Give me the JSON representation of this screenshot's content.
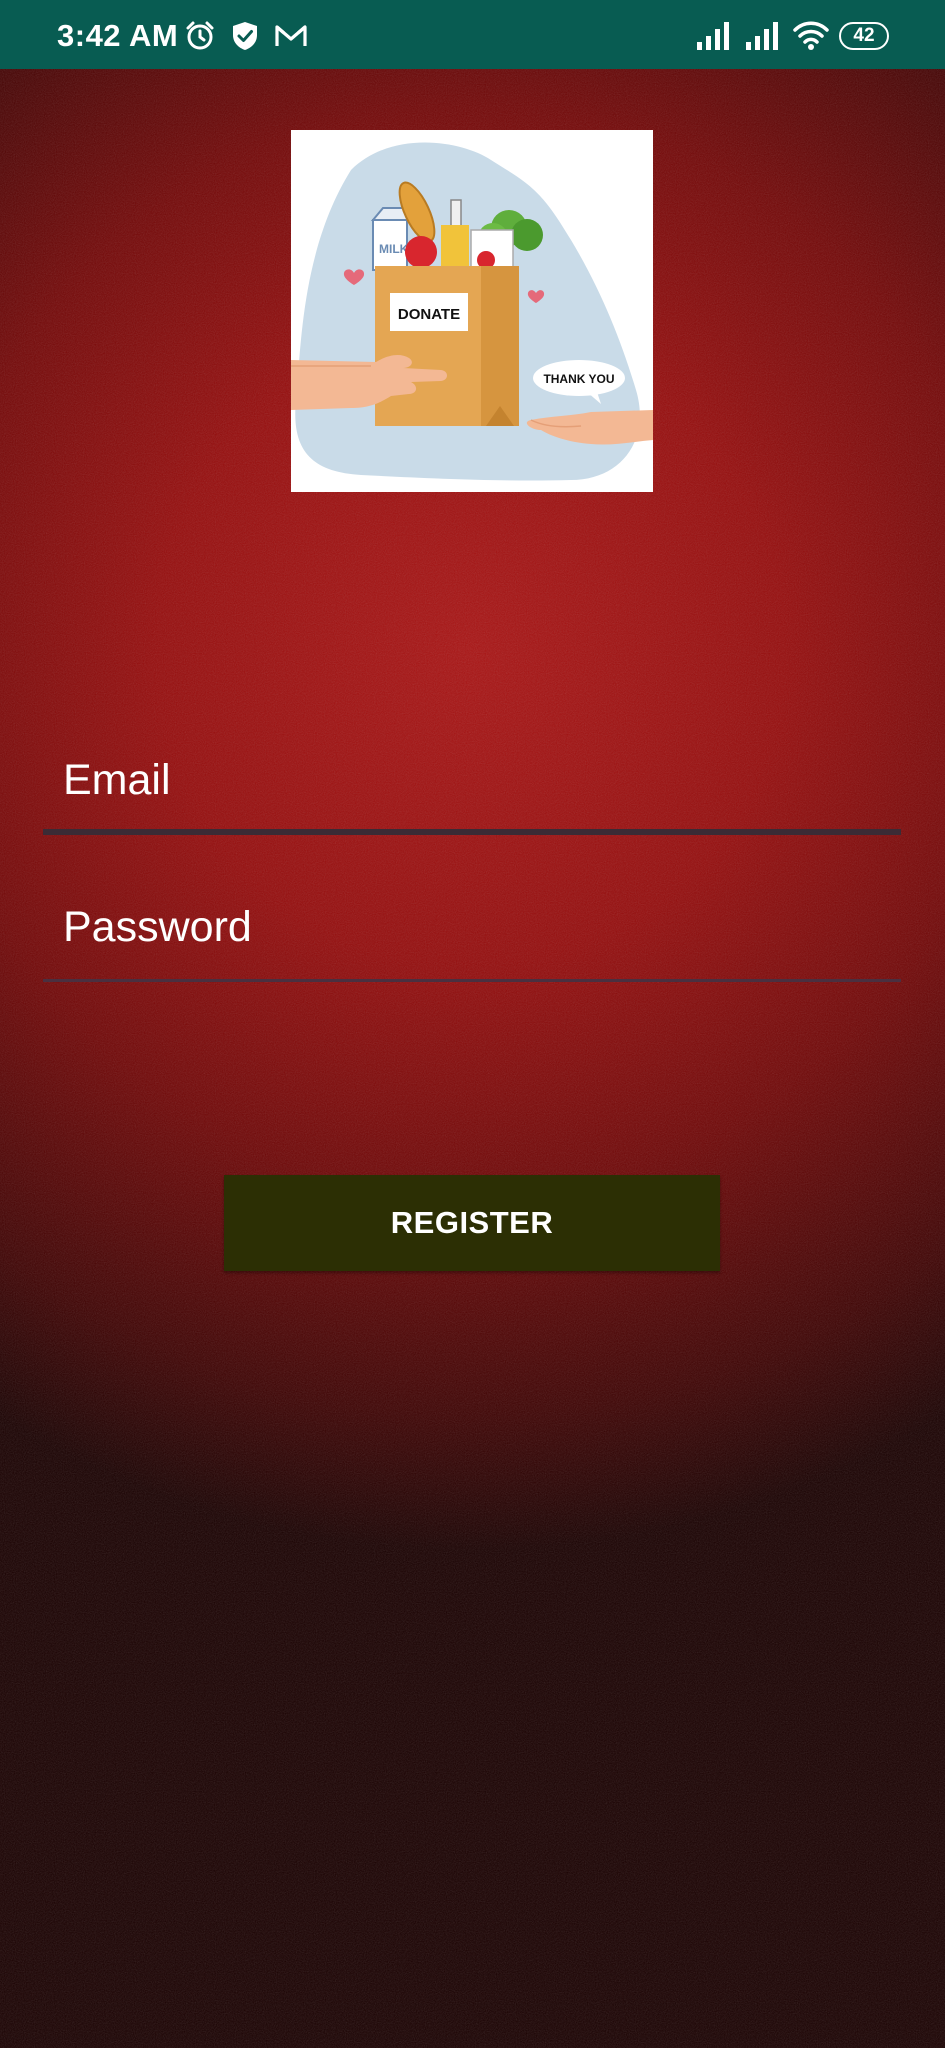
{
  "status_bar": {
    "time": "3:42 AM",
    "battery_level": "42",
    "background_color": "#085c52",
    "icons": [
      "alarm-icon",
      "shield-check-icon",
      "gmail-icon",
      "signal-icon",
      "signal-icon",
      "wifi-icon",
      "battery-icon"
    ]
  },
  "logo": {
    "bag_label": "DONATE",
    "speech_bubble": "THANK YOU",
    "carton_label": "MILK"
  },
  "form": {
    "email_placeholder": "Email",
    "password_placeholder": "Password",
    "register_label": "REGISTER"
  },
  "colors": {
    "background_top": "#9a0c0c",
    "background_bottom": "#120000",
    "button": "#2c2f04",
    "underline": "#3b2b35"
  }
}
